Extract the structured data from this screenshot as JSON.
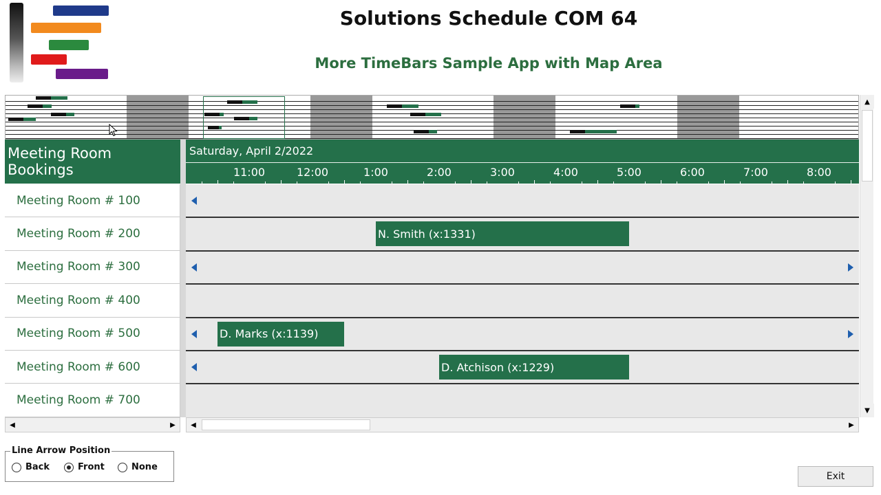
{
  "header": {
    "title": "Solutions Schedule COM 64",
    "subtitle": "More TimeBars Sample App with Map Area"
  },
  "logo": {
    "icon": "gantt-logo-icon",
    "colors": [
      "#1f3a8a",
      "#f28a1e",
      "#2b8a3e",
      "#e01b1b",
      "#6a1b8a"
    ]
  },
  "colors": {
    "accent": "#24704a",
    "row_background": "#e8e8e8",
    "arrow": "#1f5fae",
    "text_green": "#2c6e3f"
  },
  "grid": {
    "title": "Meeting Room Bookings",
    "date": "Saturday, April 2/2022",
    "hours": [
      "11:00",
      "12:00",
      "1:00",
      "2:00",
      "3:00",
      "4:00",
      "5:00",
      "6:00",
      "7:00",
      "8:00"
    ],
    "rooms": [
      "Meeting Room # 100",
      "Meeting Room # 200",
      "Meeting Room # 300",
      "Meeting Room # 400",
      "Meeting Room # 500",
      "Meeting Room # 600",
      "Meeting Room # 700"
    ],
    "bookings": [
      {
        "room_index": 1,
        "label": "N. Smith (x:1331)",
        "start": "1:00",
        "end": "5:00"
      },
      {
        "room_index": 4,
        "label": "D. Marks (x:1139)",
        "start": "10:30",
        "end": "12:30"
      },
      {
        "room_index": 5,
        "label": "D. Atchison (x:1229)",
        "start": "2:00",
        "end": "5:00"
      }
    ],
    "arrows": [
      {
        "room_index": 0,
        "direction": "left"
      },
      {
        "room_index": 2,
        "direction": "left"
      },
      {
        "room_index": 2,
        "direction": "right"
      },
      {
        "room_index": 4,
        "direction": "left"
      },
      {
        "room_index": 4,
        "direction": "right"
      },
      {
        "room_index": 5,
        "direction": "left"
      }
    ]
  },
  "options": {
    "group_label": "Line Arrow Position",
    "choices": [
      {
        "label": "Back",
        "selected": false
      },
      {
        "label": "Front",
        "selected": true
      },
      {
        "label": "None",
        "selected": false
      }
    ]
  },
  "exit_label": "Exit"
}
